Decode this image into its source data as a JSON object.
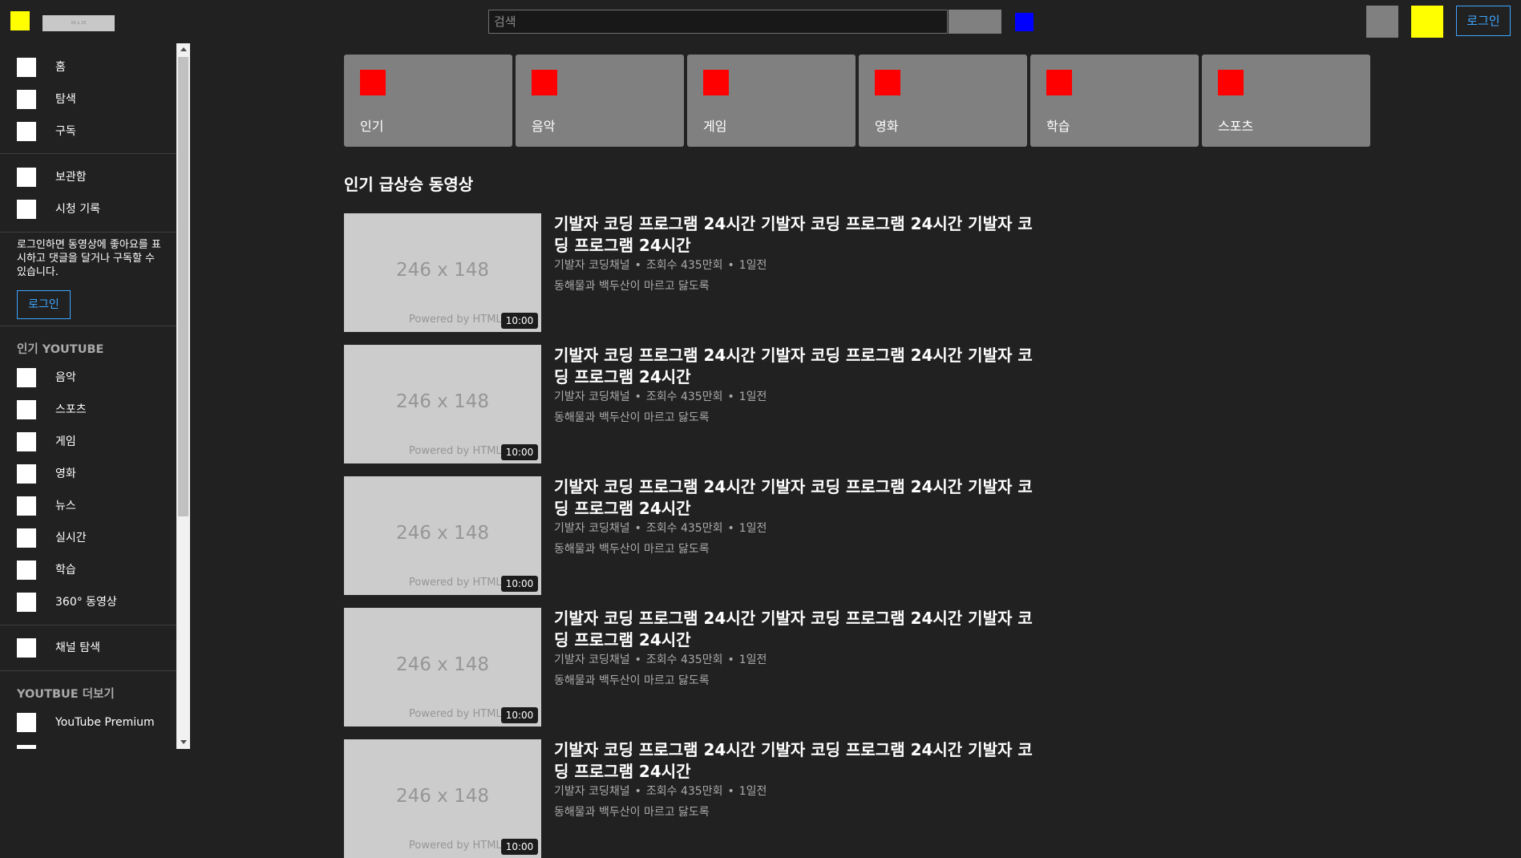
{
  "header": {
    "logo_text": "00 x 25",
    "search_placeholder": "검색",
    "login_label": "로그인"
  },
  "sidebar": {
    "main_items": [
      {
        "label": "홈"
      },
      {
        "label": "탐색"
      },
      {
        "label": "구독"
      }
    ],
    "library_items": [
      {
        "label": "보관함"
      },
      {
        "label": "시청 기록"
      }
    ],
    "login_prompt": "로그인하면 동영상에 좋아요를 표시하고 댓글을 달거나 구독할 수 있습니다.",
    "login_label": "로그인",
    "popular_heading": "인기 YOUTUBE",
    "popular_items": [
      {
        "label": "음악"
      },
      {
        "label": "스포츠"
      },
      {
        "label": "게임"
      },
      {
        "label": "영화"
      },
      {
        "label": "뉴스"
      },
      {
        "label": "실시간"
      },
      {
        "label": "학습"
      },
      {
        "label": "360° 동영상"
      }
    ],
    "channel_item": {
      "label": "채널 탐색"
    },
    "more_heading": "YOUTBUE 더보기",
    "more_items": [
      {
        "label": "YouTube Premium"
      }
    ]
  },
  "categories": [
    {
      "label": "인기"
    },
    {
      "label": "음악"
    },
    {
      "label": "게임"
    },
    {
      "label": "영화"
    },
    {
      "label": "학습"
    },
    {
      "label": "스포츠"
    }
  ],
  "section_title": "인기 급상승 동영상",
  "videos": [
    {
      "title": "기발자 코딩 프로그램 24시간 기발자 코딩 프로그램 24시간 기발자 코딩 프로그램 24시간",
      "channel": "기발자 코딩채널",
      "views": "조회수 435만회",
      "age": "1일전",
      "description": "동해물과 백두산이 마르고 닳도록",
      "thumb_text": "246 x 148",
      "thumb_caption": "Powered by HTML",
      "duration": "10:00"
    },
    {
      "title": "기발자 코딩 프로그램 24시간 기발자 코딩 프로그램 24시간 기발자 코딩 프로그램 24시간",
      "channel": "기발자 코딩채널",
      "views": "조회수 435만회",
      "age": "1일전",
      "description": "동해물과 백두산이 마르고 닳도록",
      "thumb_text": "246 x 148",
      "thumb_caption": "Powered by HTML",
      "duration": "10:00"
    },
    {
      "title": "기발자 코딩 프로그램 24시간 기발자 코딩 프로그램 24시간 기발자 코딩 프로그램 24시간",
      "channel": "기발자 코딩채널",
      "views": "조회수 435만회",
      "age": "1일전",
      "description": "동해물과 백두산이 마르고 닳도록",
      "thumb_text": "246 x 148",
      "thumb_caption": "Powered by HTML",
      "duration": "10:00"
    },
    {
      "title": "기발자 코딩 프로그램 24시간 기발자 코딩 프로그램 24시간 기발자 코딩 프로그램 24시간",
      "channel": "기발자 코딩채널",
      "views": "조회수 435만회",
      "age": "1일전",
      "description": "동해물과 백두산이 마르고 닳도록",
      "thumb_text": "246 x 148",
      "thumb_caption": "Powered by HTML",
      "duration": "10:00"
    },
    {
      "title": "기발자 코딩 프로그램 24시간 기발자 코딩 프로그램 24시간 기발자 코딩 프로그램 24시간",
      "channel": "기발자 코딩채널",
      "views": "조회수 435만회",
      "age": "1일전",
      "description": "동해물과 백두산이 마르고 닳도록",
      "thumb_text": "246 x 148",
      "thumb_caption": "Powered by HTML",
      "duration": "10:00"
    }
  ],
  "colors": {
    "background": "#212121",
    "menu_button": "#ffff00",
    "mic_button": "#0000ff",
    "apps_button": "#808080",
    "settings_button": "#ffff00",
    "accent_blue": "#3ea6ff",
    "category_icon": "#ff0000",
    "category_card": "#808080",
    "thumbnail": "#cccccc"
  }
}
